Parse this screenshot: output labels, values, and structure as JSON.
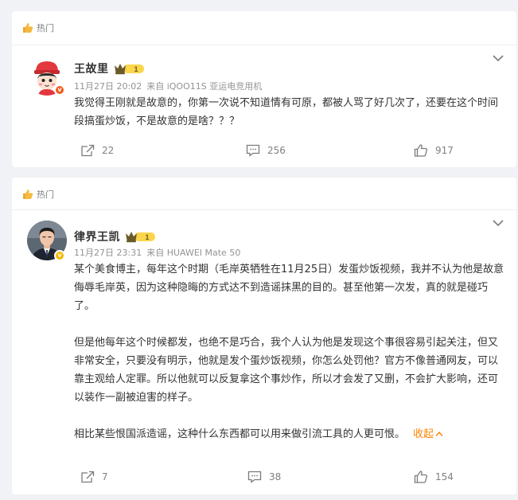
{
  "colors": {
    "accent": "#ff8200",
    "badge_orange": "#f05d1e",
    "badge_yellow": "#f5b800"
  },
  "posts": [
    {
      "hot_label": "热门",
      "author": "王故里",
      "avatar_icon": "cartoon-avatar",
      "level": "1",
      "timestamp": "11月27日 20:02",
      "source": "来自 iQOO11S 亚运电竞用机",
      "paragraphs": [
        "我觉得王刚就是故意的，你第一次说不知道情有可原，都被人骂了好几次了，还要在这个时间段搞蛋炒饭，不是故意的是啥？？？"
      ],
      "actions": {
        "repost": "22",
        "comment": "256",
        "like": "917"
      }
    },
    {
      "hot_label": "热门",
      "author": "律界王凯",
      "avatar_icon": "photo-avatar",
      "level": "1",
      "timestamp": "11月27日 23:31",
      "source": "来自 HUAWEI Mate 50",
      "paragraphs": [
        "某个美食博主，每年这个时期（毛岸英牺牲在11月25日）发蛋炒饭视频，我并不认为他是故意侮辱毛岸英，因为这种隐晦的方式达不到造谣抹黑的目的。甚至他第一次发，真的就是碰巧了。",
        "但是他每年这个时候都发，也绝不是巧合，我个人认为他是发现这个事很容易引起关注，但又非常安全，只要没有明示，他就是发个蛋炒饭视频，你怎么处罚他？官方不像普通网友，可以靠主观给人定罪。所以他就可以反复拿这个事炒作，所以才会发了又删，不会扩大影响，还可以装作一副被迫害的样子。",
        "相比某些恨国派造谣，这种什么东西都可以用来做引流工具的人更可恨。"
      ],
      "collapse_label": "收起",
      "actions": {
        "repost": "7",
        "comment": "38",
        "like": "154"
      }
    }
  ]
}
